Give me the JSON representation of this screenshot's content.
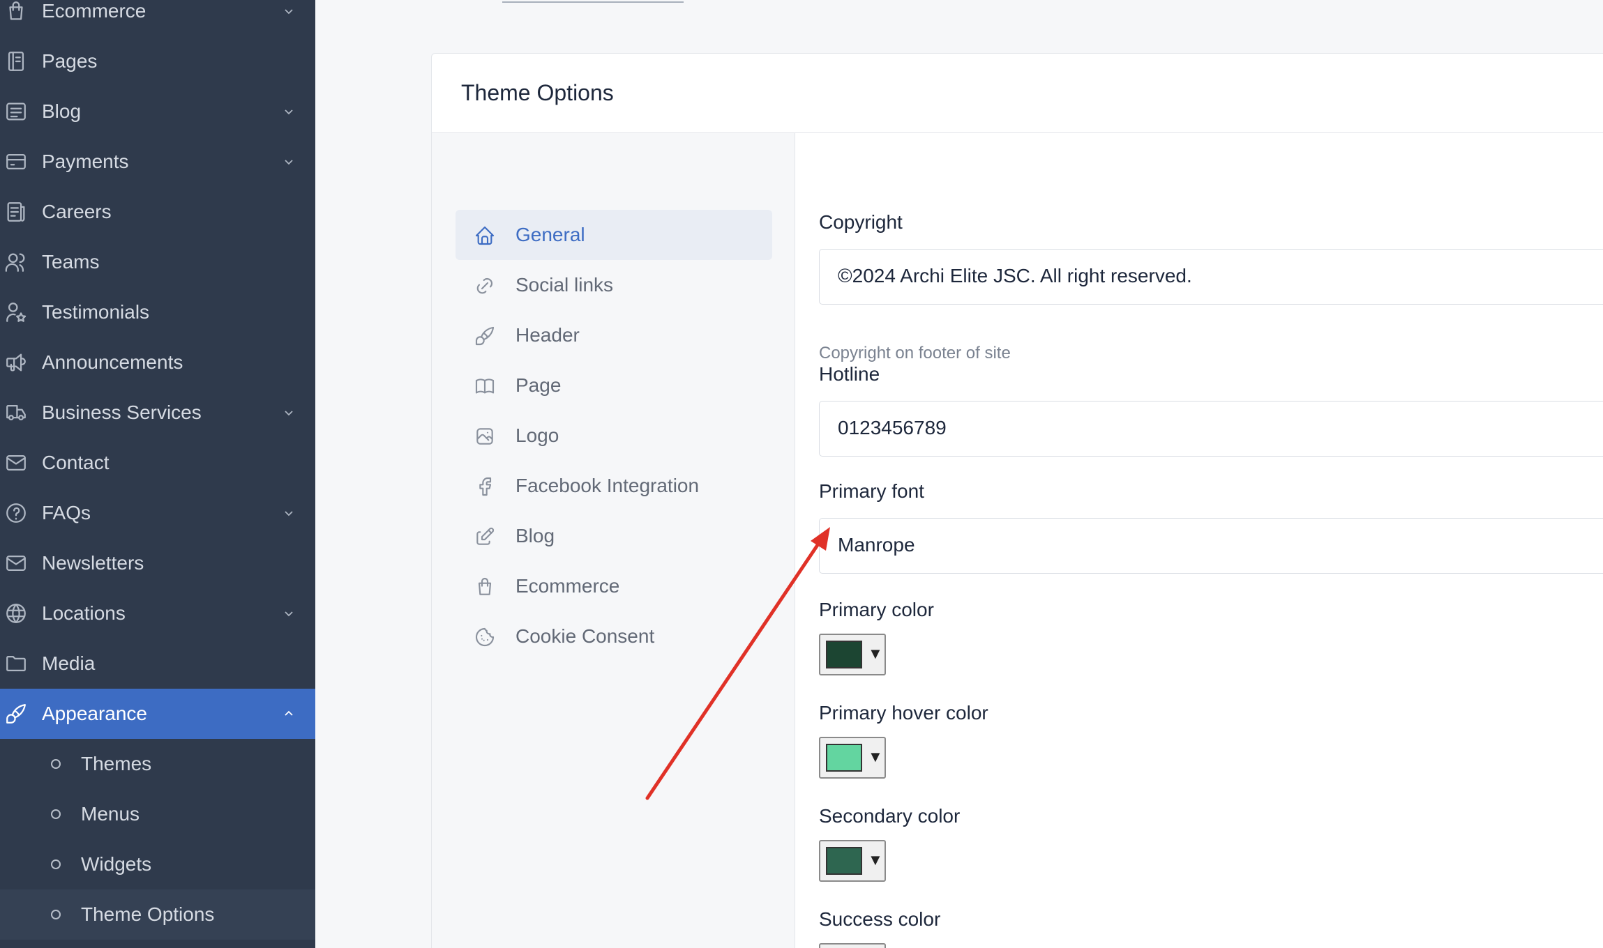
{
  "sidebar": {
    "items": [
      {
        "label": "Ecommerce",
        "icon": "shopping-bag-icon",
        "expandable": true
      },
      {
        "label": "Pages",
        "icon": "notebook-icon",
        "expandable": false
      },
      {
        "label": "Blog",
        "icon": "article-icon",
        "expandable": true
      },
      {
        "label": "Payments",
        "icon": "credit-card-icon",
        "expandable": true
      },
      {
        "label": "Careers",
        "icon": "file-text-icon",
        "expandable": false
      },
      {
        "label": "Teams",
        "icon": "users-icon",
        "expandable": false
      },
      {
        "label": "Testimonials",
        "icon": "user-star-icon",
        "expandable": false
      },
      {
        "label": "Announcements",
        "icon": "speakerphone-icon",
        "expandable": false
      },
      {
        "label": "Business Services",
        "icon": "truck-icon",
        "expandable": true
      },
      {
        "label": "Contact",
        "icon": "mail-icon",
        "expandable": false
      },
      {
        "label": "FAQs",
        "icon": "help-circle-icon",
        "expandable": true
      },
      {
        "label": "Newsletters",
        "icon": "mail-icon",
        "expandable": false
      },
      {
        "label": "Locations",
        "icon": "globe-icon",
        "expandable": true
      },
      {
        "label": "Media",
        "icon": "folder-icon",
        "expandable": false
      },
      {
        "label": "Appearance",
        "icon": "brush-icon",
        "expandable": true,
        "active": true
      }
    ],
    "subitems": [
      {
        "label": "Themes"
      },
      {
        "label": "Menus"
      },
      {
        "label": "Widgets"
      },
      {
        "label": "Theme Options",
        "current": true
      }
    ]
  },
  "card": {
    "title": "Theme Options"
  },
  "tabs": [
    {
      "label": "General",
      "icon": "home-icon",
      "active": true
    },
    {
      "label": "Social links",
      "icon": "link-icon"
    },
    {
      "label": "Header",
      "icon": "brush-icon"
    },
    {
      "label": "Page",
      "icon": "book-icon"
    },
    {
      "label": "Logo",
      "icon": "photo-icon"
    },
    {
      "label": "Facebook Integration",
      "icon": "facebook-icon"
    },
    {
      "label": "Blog",
      "icon": "edit-icon"
    },
    {
      "label": "Ecommerce",
      "icon": "shopping-bag-icon"
    },
    {
      "label": "Cookie Consent",
      "icon": "cookie-icon"
    }
  ],
  "form": {
    "copyright": {
      "label": "Copyright",
      "value": "©2024 Archi Elite JSC. All right reserved.",
      "hint": "Copyright on footer of site"
    },
    "hotline": {
      "label": "Hotline",
      "value": "0123456789"
    },
    "primary_font": {
      "label": "Primary font",
      "value": "Manrope"
    },
    "colors": [
      {
        "label": "Primary color",
        "value": "#1c4532"
      },
      {
        "label": "Primary hover color",
        "value": "#63d5a0"
      },
      {
        "label": "Secondary color",
        "value": "#2e6650"
      },
      {
        "label": "Success color",
        "value": "#63d5a0"
      }
    ],
    "dropdown_glyph": "▼"
  },
  "colors": {
    "sidebar_bg": "#2f3a4c",
    "sidebar_active": "#3d6cc3",
    "accent": "#3d6cc3",
    "annotation_arrow": "#e03127"
  }
}
